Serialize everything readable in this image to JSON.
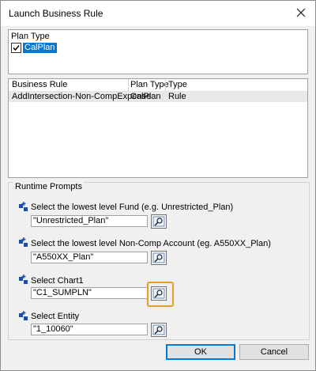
{
  "window": {
    "title": "Launch Business Rule"
  },
  "plan_type": {
    "label": "Plan Type",
    "items": [
      {
        "label": "CalPlan",
        "checked": true
      }
    ]
  },
  "rules_table": {
    "columns": [
      "Business Rule",
      "Plan Type",
      "Type"
    ],
    "rows": [
      [
        "AddIntersection-Non-CompExpense",
        "CalPlan",
        "Rule"
      ]
    ]
  },
  "runtime": {
    "legend": "Runtime Prompts",
    "prompts": [
      {
        "label": "Select the lowest level Fund (e.g. Unrestricted_Plan)",
        "value": "\"Unrestricted_Plan\""
      },
      {
        "label": "Select the lowest level Non-Comp Account (eg. A550XX_Plan)",
        "value": "\"A550XX_Plan\""
      },
      {
        "label": "Select Chart1",
        "value": "\"C1_SUMPLN\""
      },
      {
        "label": "Select Entity",
        "value": "\"1_10060\""
      }
    ]
  },
  "buttons": {
    "ok": "OK",
    "cancel": "Cancel"
  },
  "colors": {
    "selection": "#0078d7",
    "highlight": "#e0a030"
  },
  "icons": {
    "close": "close-icon",
    "prompt": "member-prompt-icon",
    "lookup": "member-selector-icon"
  }
}
